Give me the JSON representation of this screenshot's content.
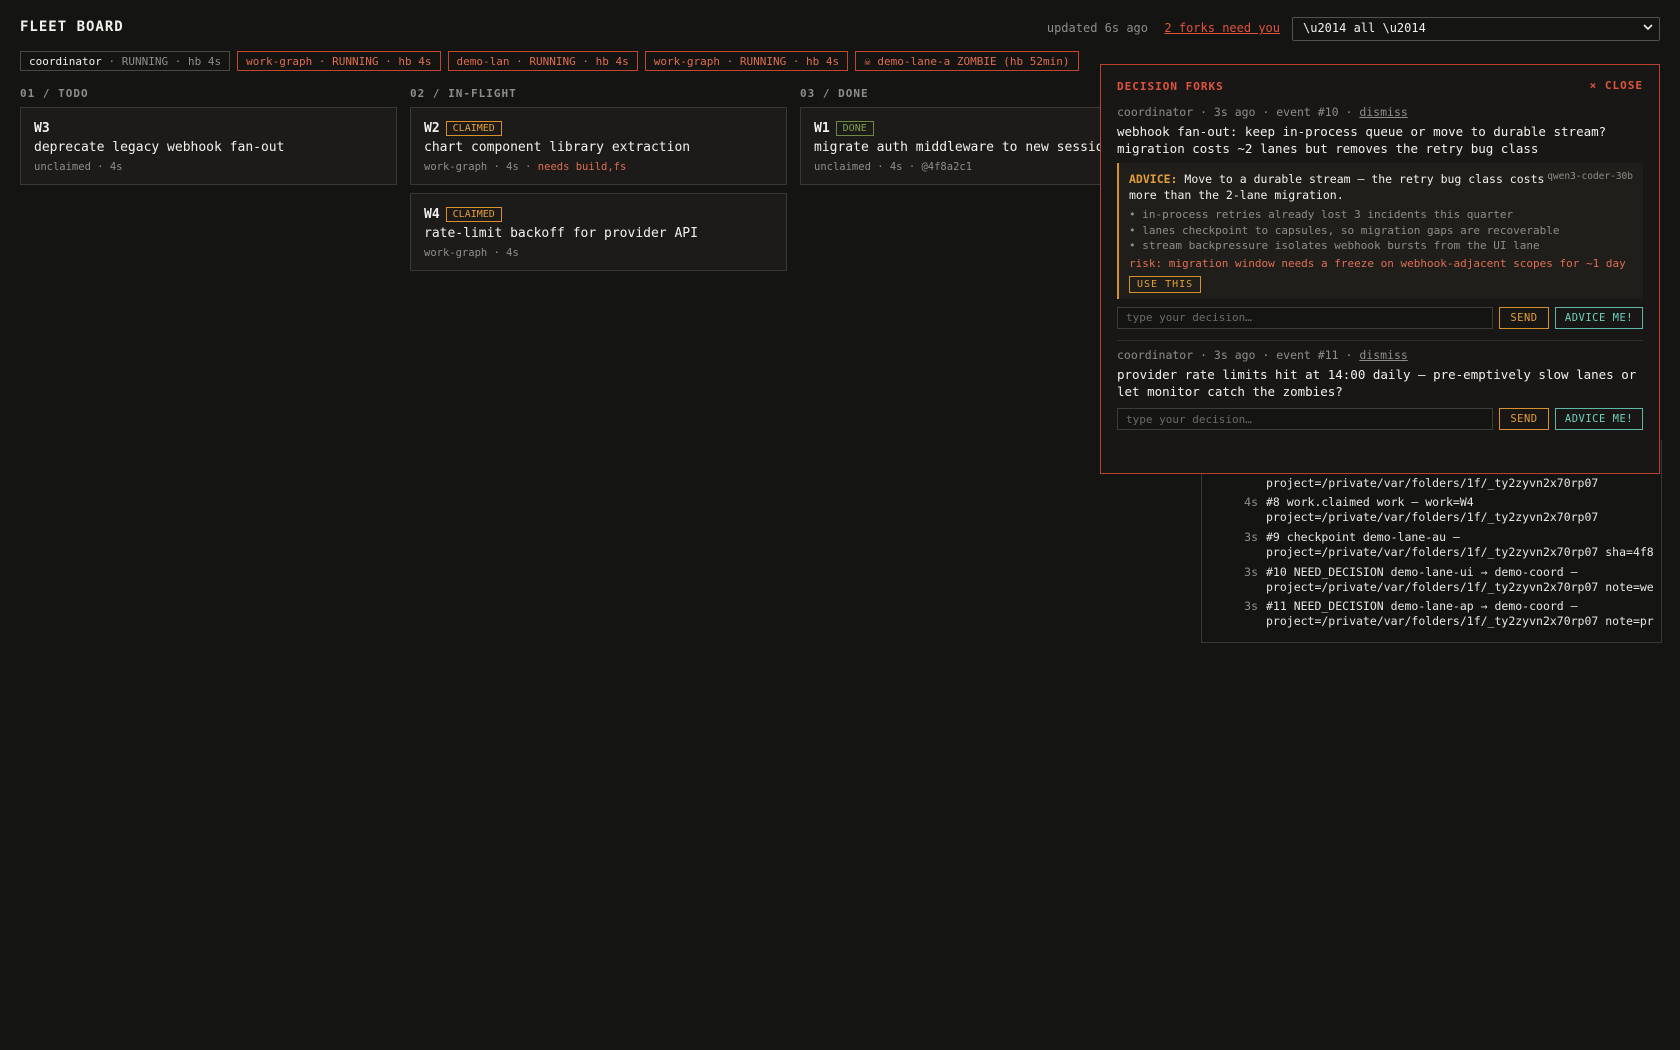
{
  "header": {
    "title": "FLEET BOARD",
    "updated": "updated 6s ago",
    "forks_link": "2 forks need you",
    "scope_value": "\\u2014 all \\u2014"
  },
  "lanes": [
    {
      "name": "coordinator",
      "status": " · RUNNING · hb 4s",
      "state": "ok"
    },
    {
      "name": "work-graph",
      "status": " · RUNNING · hb 4s",
      "state": "alert"
    },
    {
      "name": "demo-lan",
      "status": " · RUNNING · hb 4s",
      "state": "alert"
    },
    {
      "name": "work-graph",
      "status": " · RUNNING · hb 4s",
      "state": "alert"
    },
    {
      "name": "☠ demo-lane-a",
      "status": " ZOMBIE (hb 52min)",
      "state": "alert"
    }
  ],
  "columns": [
    {
      "title": "01 / TODO",
      "cards": [
        {
          "id": "W3",
          "badge": "",
          "title": "deprecate legacy webhook fan-out",
          "meta": "unclaimed · 4s",
          "warn": ""
        }
      ]
    },
    {
      "title": "02 / IN-FLIGHT",
      "cards": [
        {
          "id": "W2",
          "badge": "CLAIMED",
          "title": "chart component library extraction",
          "meta": "work-graph · 4s · ",
          "warn": "needs build,fs"
        },
        {
          "id": "W4",
          "badge": "CLAIMED",
          "title": "rate-limit backoff for provider API",
          "meta": "work-graph · 4s",
          "warn": ""
        }
      ]
    },
    {
      "title": "03 / DONE",
      "cards": [
        {
          "id": "W1",
          "badge": "DONE",
          "title": "migrate auth middleware to new session",
          "meta": "unclaimed · 4s · @4f8a2c1",
          "warn": ""
        }
      ]
    }
  ],
  "events": [
    {
      "age": "",
      "line1": "project=/private/var/folders/1f/_ty2zyvn2x70rp07",
      "line2": ""
    },
    {
      "age": "4s",
      "line1": "#8 work.claimed work — work=W4",
      "line2": "project=/private/var/folders/1f/_ty2zyvn2x70rp07"
    },
    {
      "age": "3s",
      "line1": "#9 checkpoint demo-lane-au —",
      "line2": "project=/private/var/folders/1f/_ty2zyvn2x70rp07 sha=4f8"
    },
    {
      "age": "3s",
      "line1": "#10 NEED_DECISION demo-lane-ui → demo-coord —",
      "line2": "project=/private/var/folders/1f/_ty2zyvn2x70rp07 note=we"
    },
    {
      "age": "3s",
      "line1": "#11 NEED_DECISION demo-lane-ap → demo-coord —",
      "line2": "project=/private/var/folders/1f/_ty2zyvn2x70rp07 note=pr"
    }
  ],
  "panel": {
    "title": "DECISION FORKS",
    "close": "× CLOSE",
    "forks": [
      {
        "meta": "coordinator · 3s ago · event #10 · ",
        "dismiss": "dismiss",
        "question": "webhook fan-out: keep in-process queue or move to durable stream? migration costs ~2 lanes but removes the retry bug class",
        "advice": {
          "tag": "ADVICE:",
          "text": " Move to a durable stream — the retry bug class costs more than the 2-lane migration.",
          "model": "qwen3-coder-30b",
          "bullets": [
            "• in-process retries already lost 3 incidents this quarter",
            "• lanes checkpoint to capsules, so migration gaps are recoverable",
            "• stream backpressure isolates webhook bursts from the UI lane"
          ],
          "risk": "risk: migration window needs a freeze on webhook-adjacent scopes for ~1 day",
          "use": "USE THIS"
        },
        "placeholder": "type your decision…",
        "send": "SEND",
        "advice_btn": "ADVICE ME!"
      },
      {
        "meta": "coordinator · 3s ago · event #11 · ",
        "dismiss": "dismiss",
        "question": "provider rate limits hit at 14:00 daily — pre-emptively slow lanes or let monitor catch the zombies?",
        "placeholder": "type your decision…",
        "send": "SEND",
        "advice_btn": "ADVICE ME!"
      }
    ]
  },
  "colors": {
    "background": "#141412",
    "alert": "#e0533d",
    "claimed": "#e39e3a",
    "done": "#7f9e4a",
    "advice_button": "#6fd0bd"
  }
}
